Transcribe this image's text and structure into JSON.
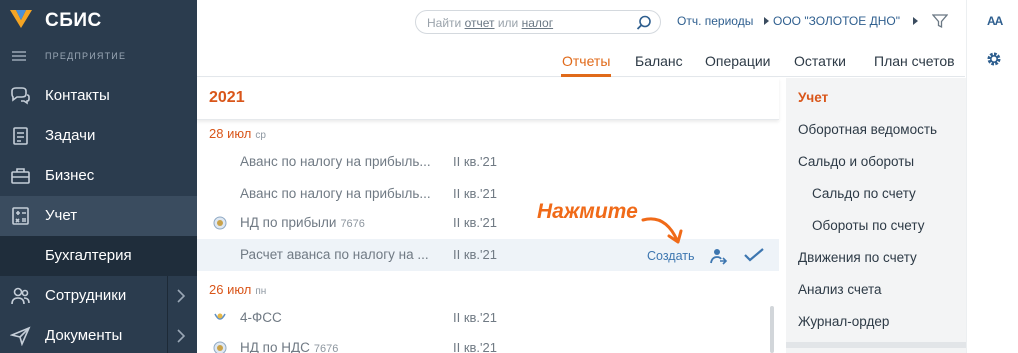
{
  "sidebar": {
    "brand": "СБИС",
    "company": "ПРЕДПРИЯТИЕ",
    "items": [
      {
        "label": "Контакты"
      },
      {
        "label": "Задачи"
      },
      {
        "label": "Бизнес"
      },
      {
        "label": "Учет"
      },
      {
        "label": "Бухгалтерия"
      },
      {
        "label": "Сотрудники"
      },
      {
        "label": "Документы"
      }
    ]
  },
  "header": {
    "search": {
      "prefix": "Найти ",
      "link1": "отчет",
      "middle": " или ",
      "link2": "налог"
    },
    "periods": "Отч. периоды",
    "org": "ООО \"ЗОЛОТОЕ ДНО\""
  },
  "tabs": [
    "Отчеты",
    "Баланс",
    "Операции",
    "Остатки",
    "План счетов"
  ],
  "year": "2021",
  "groups": [
    {
      "day": "28 июл",
      "dow": "ср",
      "rows": [
        {
          "name": "Аванс по налогу на прибыль...",
          "num": "",
          "period": "II кв.'21"
        },
        {
          "name": "Аванс по налогу на прибыль...",
          "num": "",
          "period": "II кв.'21"
        },
        {
          "name": "НД по прибыли",
          "num": "7676",
          "period": "II кв.'21"
        },
        {
          "name": "Расчет аванса по налогу на ...",
          "num": "",
          "period": "II кв.'21",
          "action": "Создать"
        }
      ]
    },
    {
      "day": "26 июл",
      "dow": "пн",
      "rows": [
        {
          "name": "4-ФСС",
          "num": "",
          "period": "II кв.'21"
        },
        {
          "name": "НД по НДС",
          "num": "7676",
          "period": "II кв.'21"
        }
      ]
    }
  ],
  "hint": "Нажмите",
  "right_panel": {
    "items": [
      {
        "label": "Учет"
      },
      {
        "label": "Оборотная ведомость"
      },
      {
        "label": "Сальдо и обороты"
      },
      {
        "label": "Сальдо по счету"
      },
      {
        "label": "Обороты по счету"
      },
      {
        "label": "Движения по счету"
      },
      {
        "label": "Анализ счета"
      },
      {
        "label": "Журнал-ордер"
      }
    ]
  },
  "rail": {
    "font_button": "AA"
  },
  "colors": {
    "sidebar": "#2b3c4e",
    "accent": "#e06a1a",
    "link": "#2f5f8f"
  }
}
